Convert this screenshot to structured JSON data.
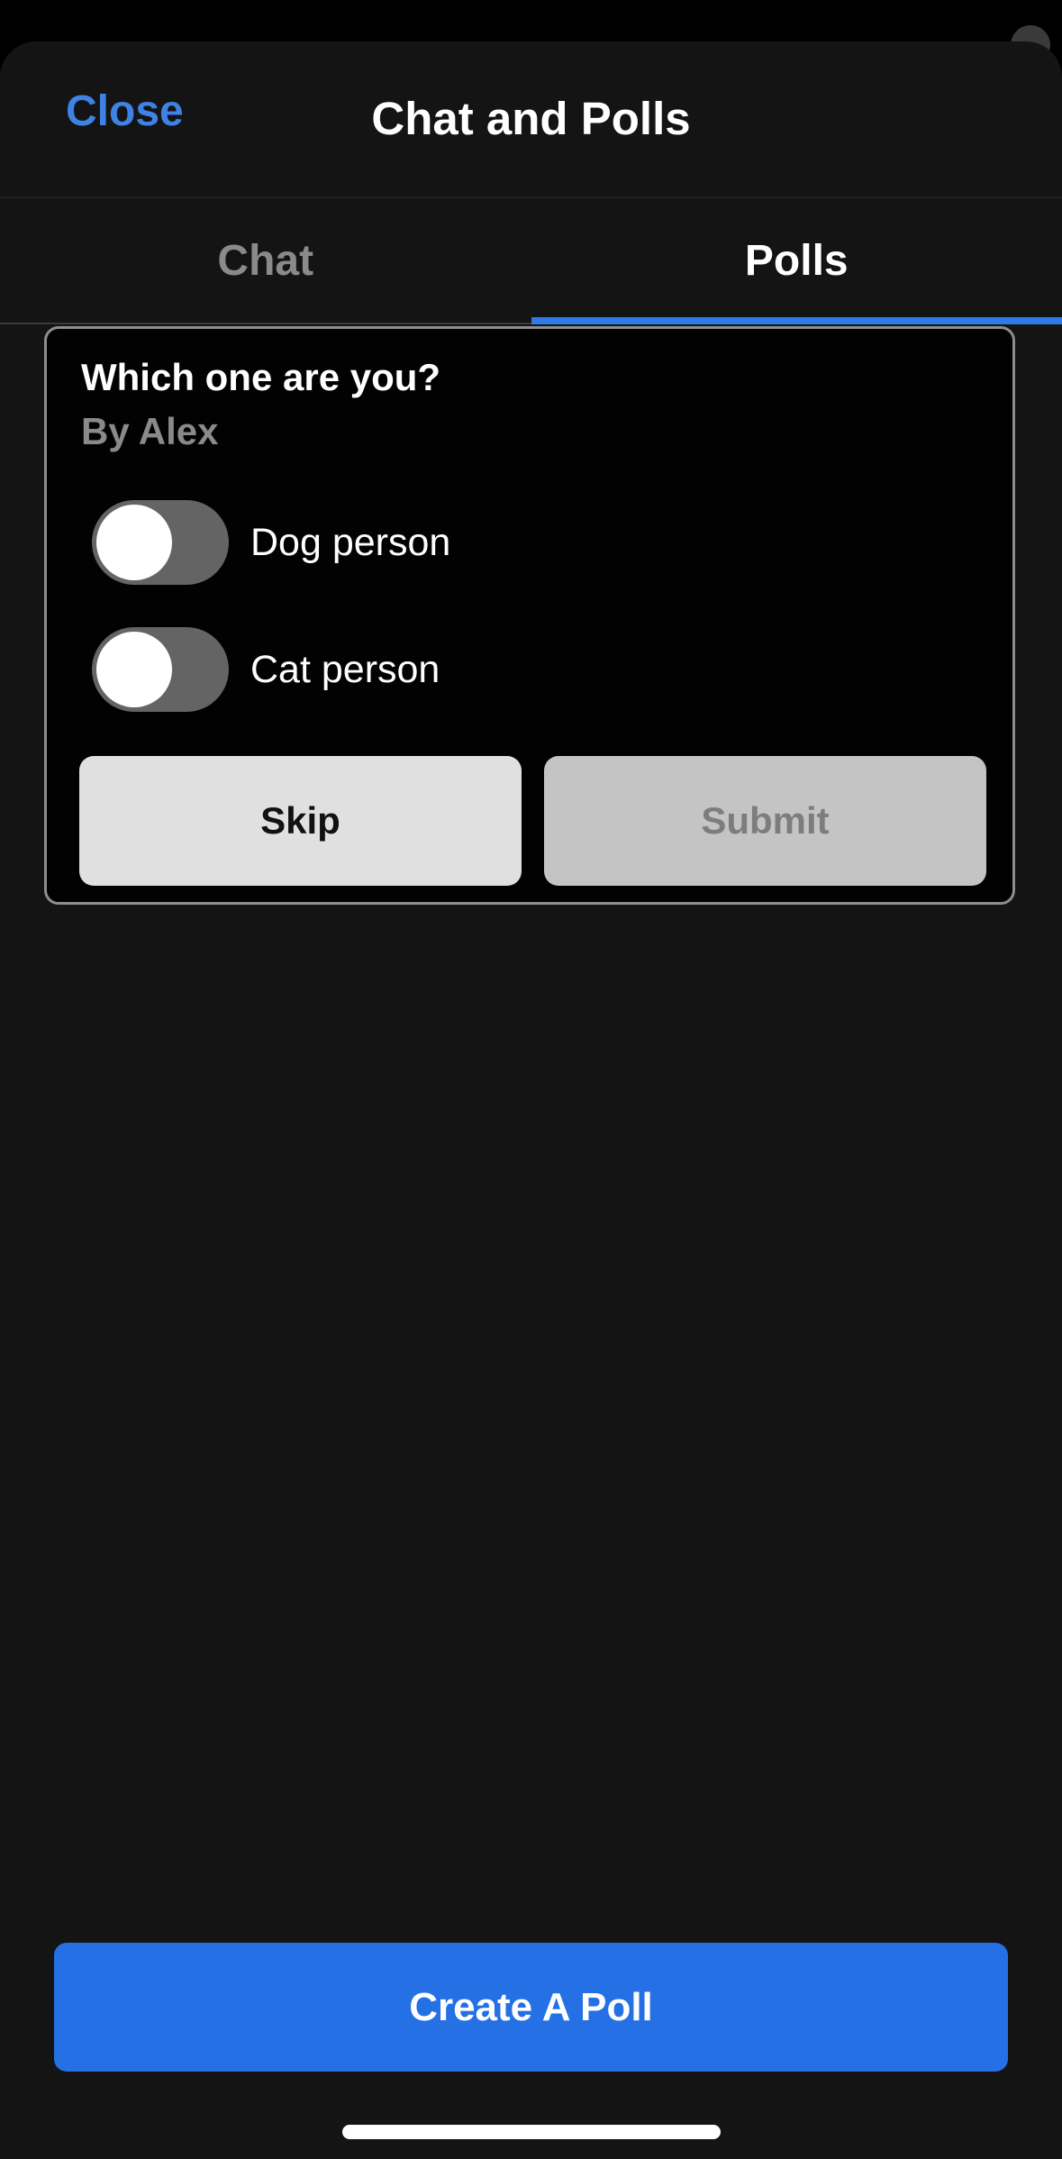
{
  "header": {
    "close_label": "Close",
    "title": "Chat and Polls"
  },
  "tabs": [
    {
      "label": "Chat",
      "active": false
    },
    {
      "label": "Polls",
      "active": true
    }
  ],
  "poll": {
    "question": "Which one are you?",
    "author": "By Alex",
    "options": [
      {
        "label": "Dog person",
        "selected": false
      },
      {
        "label": "Cat person",
        "selected": false
      }
    ],
    "skip_label": "Skip",
    "submit_label": "Submit"
  },
  "footer": {
    "create_label": "Create A Poll"
  },
  "colors": {
    "accent": "#2470e4",
    "link": "#3e82e6",
    "background": "#141414"
  }
}
